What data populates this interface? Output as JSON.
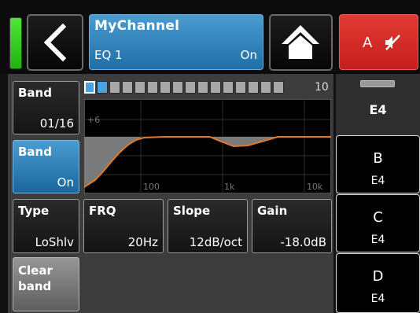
{
  "header": {
    "channel_name": "MyChannel",
    "channel_sub": "EQ 1",
    "channel_state": "On",
    "mute_label": "A",
    "colors": {
      "meter": "#3fd42a",
      "channel": "#2f86c0",
      "mute": "#d72a26"
    },
    "icons": {
      "back": "chevron-left-icon",
      "home": "home-icon",
      "mute": "speaker-muted-icon"
    }
  },
  "band_select": {
    "label": "Band",
    "value": "01/16"
  },
  "band_on": {
    "label": "Band",
    "value": "On"
  },
  "band_strip": {
    "total": 10,
    "selected": 1,
    "count_label": "10"
  },
  "graph": {
    "y_label": "+6",
    "x_labels": [
      "100",
      "1k",
      "10k"
    ],
    "curve_color": "#e0782c"
  },
  "params": {
    "type": {
      "label": "Type",
      "value": "LoShlv"
    },
    "frq": {
      "label": "FRQ",
      "value": "20Hz"
    },
    "slope": {
      "label": "Slope",
      "value": "12dB/oct"
    },
    "gain": {
      "label": "Gain",
      "value": "-18.0dB"
    }
  },
  "clear_band": {
    "line1": "Clear",
    "line2": "band"
  },
  "slots": {
    "a": {
      "label": "E4"
    },
    "b": {
      "letter": "B",
      "label": "E4"
    },
    "c": {
      "letter": "C",
      "label": "E4"
    },
    "d": {
      "letter": "D",
      "label": "E4"
    }
  }
}
